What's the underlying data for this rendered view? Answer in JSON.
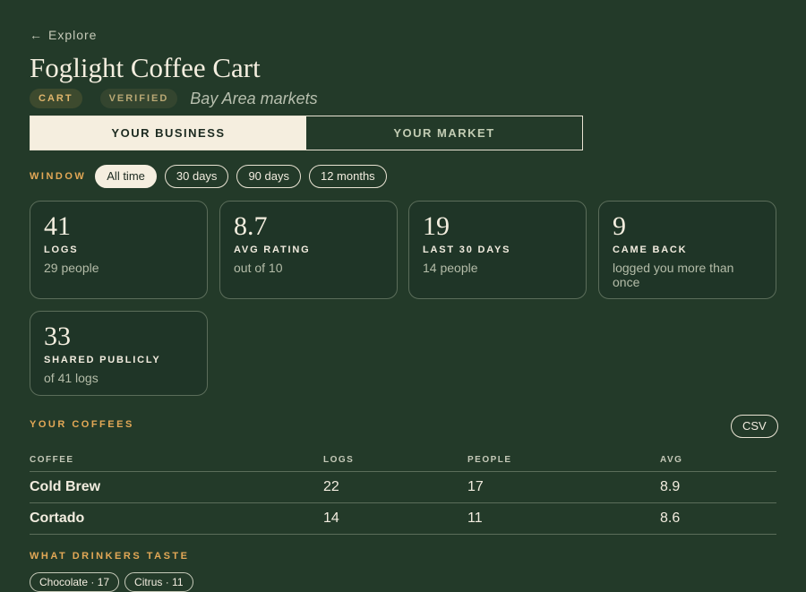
{
  "nav": {
    "back_label": "Explore",
    "back_arrow": "←"
  },
  "header": {
    "title": "Foglight Coffee Cart",
    "badges": [
      "CART",
      "VERIFIED"
    ],
    "region": "Bay Area markets"
  },
  "tabs": [
    {
      "label": "YOUR BUSINESS",
      "active": true
    },
    {
      "label": "YOUR MARKET",
      "active": false
    }
  ],
  "window": {
    "label": "WINDOW",
    "options": [
      "All time",
      "30 days",
      "90 days",
      "12 months"
    ],
    "selected": "All time"
  },
  "stats": [
    {
      "value": "41",
      "label": "LOGS",
      "sub": "29 people"
    },
    {
      "value": "8.7",
      "label": "AVG RATING",
      "sub": "out of 10"
    },
    {
      "value": "19",
      "label": "LAST 30 DAYS",
      "sub": "14 people"
    },
    {
      "value": "9",
      "label": "CAME BACK",
      "sub": "logged you more than once"
    },
    {
      "value": "33",
      "label": "SHARED PUBLICLY",
      "sub": "of 41 logs"
    }
  ],
  "coffees": {
    "title": "YOUR COFFEES",
    "csv_label": "CSV",
    "columns": [
      "COFFEE",
      "LOGS",
      "PEOPLE",
      "AVG"
    ],
    "rows": [
      [
        "Cold Brew",
        "22",
        "17",
        "8.9"
      ],
      [
        "Cortado",
        "14",
        "11",
        "8.6"
      ]
    ]
  },
  "tastes": {
    "title": "WHAT DRINKERS TASTE",
    "items": [
      "Chocolate · 17",
      "Citrus · 11"
    ]
  },
  "colors": {
    "background": "#233a29",
    "accent": "#e3a856",
    "cream": "#f5eedf"
  }
}
